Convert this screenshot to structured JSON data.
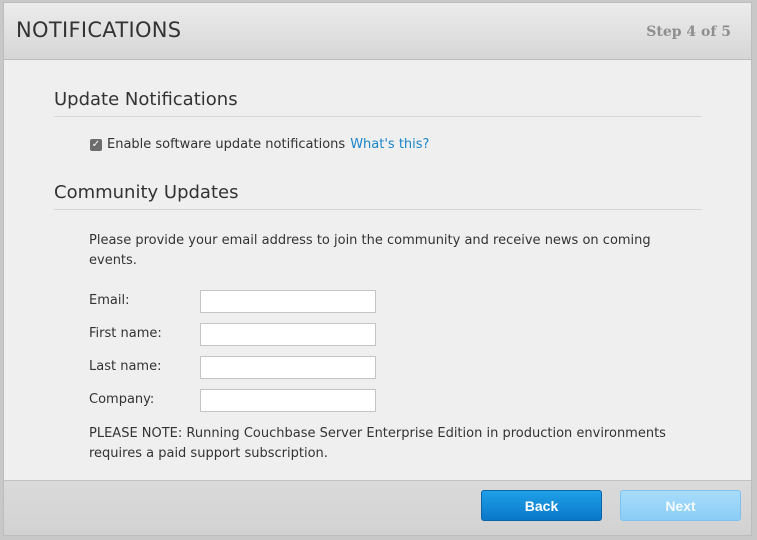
{
  "header": {
    "title": "NOTIFICATIONS",
    "step": "Step 4 of 5"
  },
  "update_section": {
    "title": "Update Notifications",
    "checkbox_label": "Enable software update notifications",
    "checkbox_checked": true,
    "help_link": "What's this?"
  },
  "community_section": {
    "title": "Community Updates",
    "intro": "Please provide your email address to join the community and receive news on coming events.",
    "fields": {
      "email": {
        "label": "Email:",
        "value": ""
      },
      "first_name": {
        "label": "First name:",
        "value": ""
      },
      "last_name": {
        "label": "Last name:",
        "value": ""
      },
      "company": {
        "label": "Company:",
        "value": ""
      }
    },
    "note": "PLEASE NOTE: Running Couchbase Server Enterprise Edition in production environments requires a paid support subscription."
  },
  "footer": {
    "back_label": "Back",
    "next_label": "Next"
  },
  "colors": {
    "link": "#1a86c8",
    "primary_button": "#0a77c8",
    "disabled_button": "#8acdf6"
  },
  "icons": {
    "checkbox": "check-icon"
  }
}
